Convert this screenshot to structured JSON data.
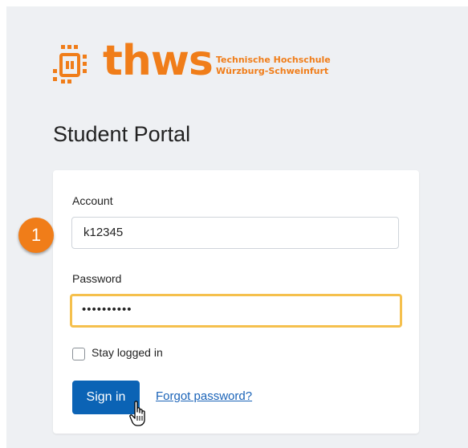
{
  "logo": {
    "wordmark": "thws",
    "subtitle_line1": "Technische Hochschule",
    "subtitle_line2": "Würzburg-Schweinfurt",
    "brand_color": "#f07d19"
  },
  "page": {
    "title": "Student Portal"
  },
  "form": {
    "account_label": "Account",
    "account_value": "k12345",
    "password_label": "Password",
    "password_value": "••••••••••",
    "stay_logged_in_label": "Stay logged in",
    "stay_logged_in_checked": false,
    "sign_in_label": "Sign in",
    "forgot_password_label": "Forgot password?"
  },
  "annotation": {
    "step_number": "1"
  },
  "icons": {
    "cursor": "hand-pointer-icon",
    "logo_mark": "thws-logo-mark-icon"
  }
}
